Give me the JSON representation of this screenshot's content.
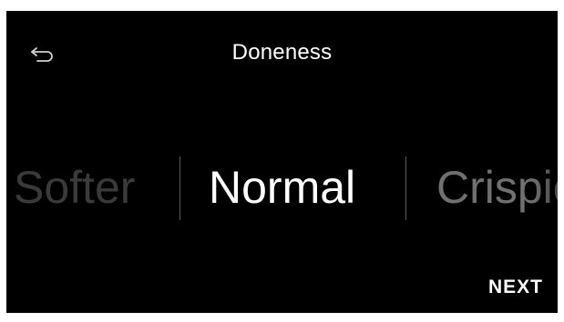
{
  "header": {
    "title": "Doneness",
    "back_icon": "back-arrow-icon"
  },
  "picker": {
    "options": [
      "Softer",
      "Normal",
      "Crispier"
    ],
    "selected": "Normal"
  },
  "footer": {
    "next_label": "NEXT"
  },
  "colors": {
    "background": "#000000",
    "text": "#ffffff",
    "dim_text": "#3a3a3a",
    "divider": "#5a5a5a"
  }
}
